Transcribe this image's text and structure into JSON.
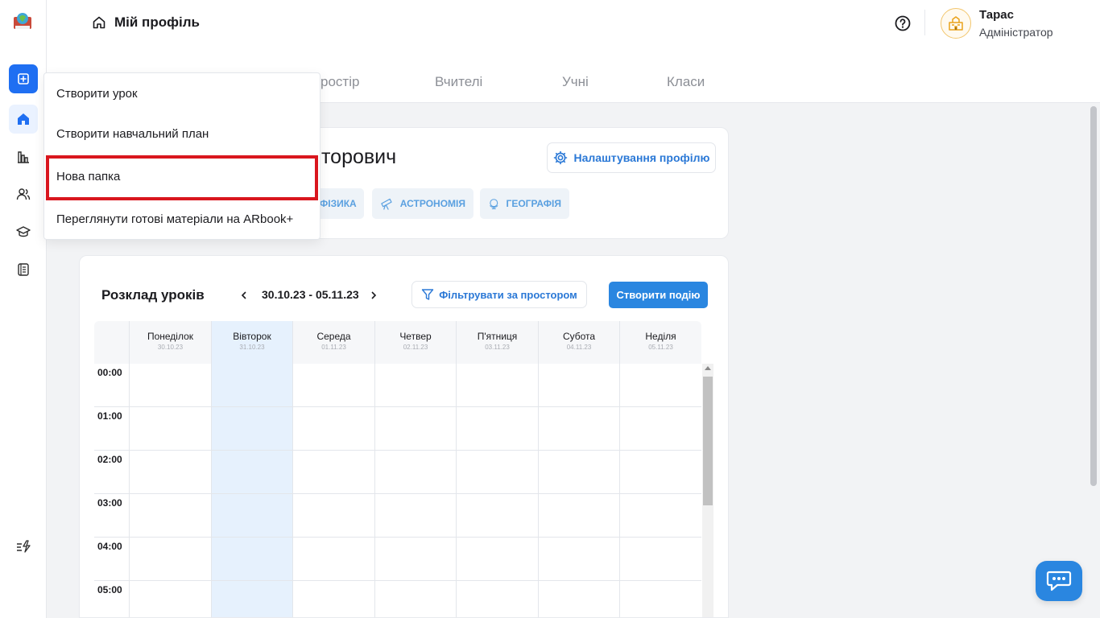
{
  "header": {
    "title": "Мій профіль",
    "user": {
      "name": "Тарас",
      "role": "Адміністратор"
    },
    "tabs": [
      "ростір",
      "Вчителі",
      "Учні",
      "Класи"
    ]
  },
  "sidebar": {
    "icons": [
      "plus-icon",
      "home-icon",
      "chart-bar-icon",
      "users-icon",
      "graduation-cap-icon",
      "notebook-icon",
      "lightning-list-icon"
    ]
  },
  "dropdown": {
    "items": [
      "Створити урок",
      "Створити навчальний план",
      "Нова папка",
      "Переглянути готові матеріали на ARbook+"
    ]
  },
  "profile": {
    "name_fragment": "торович",
    "settings_label": "Налаштування профілю",
    "subjects": [
      "ФІЗИКА",
      "АСТРОНОМІЯ",
      "ГЕОГРАФІЯ"
    ]
  },
  "schedule": {
    "title": "Розклад уроків",
    "date_range": "30.10.23 - 05.11.23",
    "filter_label": "Фільтрувати за простором",
    "create_event_label": "Створити подію",
    "days": [
      {
        "name": "Понеділок",
        "date": "30.10.23"
      },
      {
        "name": "Вівторок",
        "date": "31.10.23"
      },
      {
        "name": "Середа",
        "date": "01.11.23"
      },
      {
        "name": "Четвер",
        "date": "02.11.23"
      },
      {
        "name": "П'ятниця",
        "date": "03.11.23"
      },
      {
        "name": "Субота",
        "date": "04.11.23"
      },
      {
        "name": "Неділя",
        "date": "05.11.23"
      }
    ],
    "hours": [
      "00:00",
      "01:00",
      "02:00",
      "03:00",
      "04:00",
      "05:00"
    ]
  },
  "colors": {
    "accent": "#2a86e0",
    "primary_button": "#1f6ff2",
    "highlight_border": "#d9161e",
    "today_column": "#e6f1fd"
  }
}
